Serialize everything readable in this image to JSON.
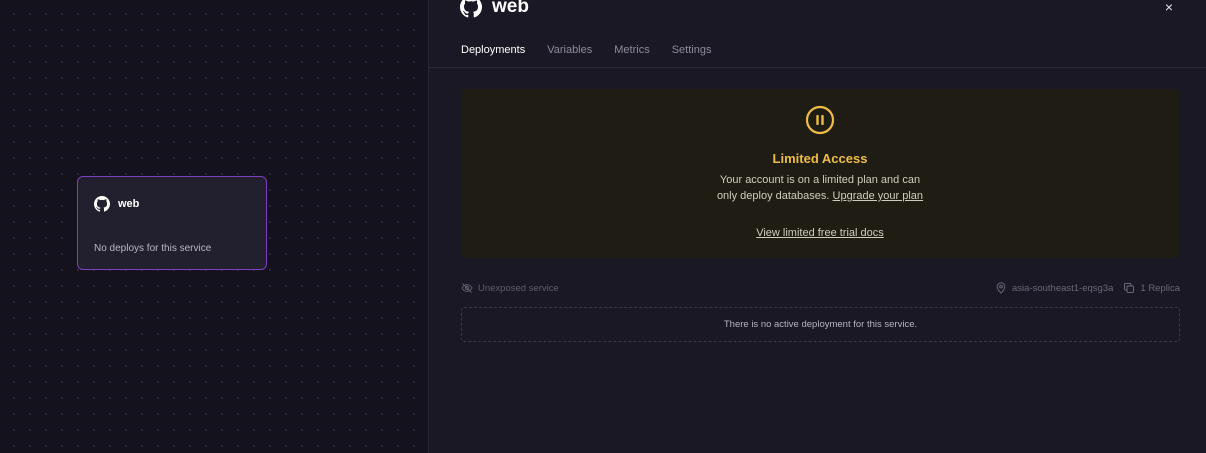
{
  "canvas": {
    "service_card": {
      "title": "web",
      "subtitle": "No deploys for this service",
      "icon": "github-icon"
    }
  },
  "panel": {
    "title": "web",
    "icon": "github-icon",
    "close_label": "×",
    "tabs": [
      {
        "label": "Deployments",
        "active": true
      },
      {
        "label": "Variables",
        "active": false
      },
      {
        "label": "Metrics",
        "active": false
      },
      {
        "label": "Settings",
        "active": false
      }
    ],
    "banner": {
      "icon": "pause-icon",
      "title": "Limited Access",
      "text_line1": "Your account is on a limited plan and can",
      "text_line2_prefix": "only deploy databases. ",
      "upgrade_link": "Upgrade your plan",
      "docs_link": "View limited free trial docs"
    },
    "meta": {
      "exposure": "Unexposed service",
      "region": "asia-southeast1-eqsg3a",
      "replicas": "1 Replica"
    },
    "empty_state": "There is no active deployment for this service."
  },
  "colors": {
    "accent_purple": "#7d3fbf",
    "warning_yellow": "#efbc46",
    "panel_bg": "#1a1824",
    "canvas_bg": "#14121c"
  }
}
